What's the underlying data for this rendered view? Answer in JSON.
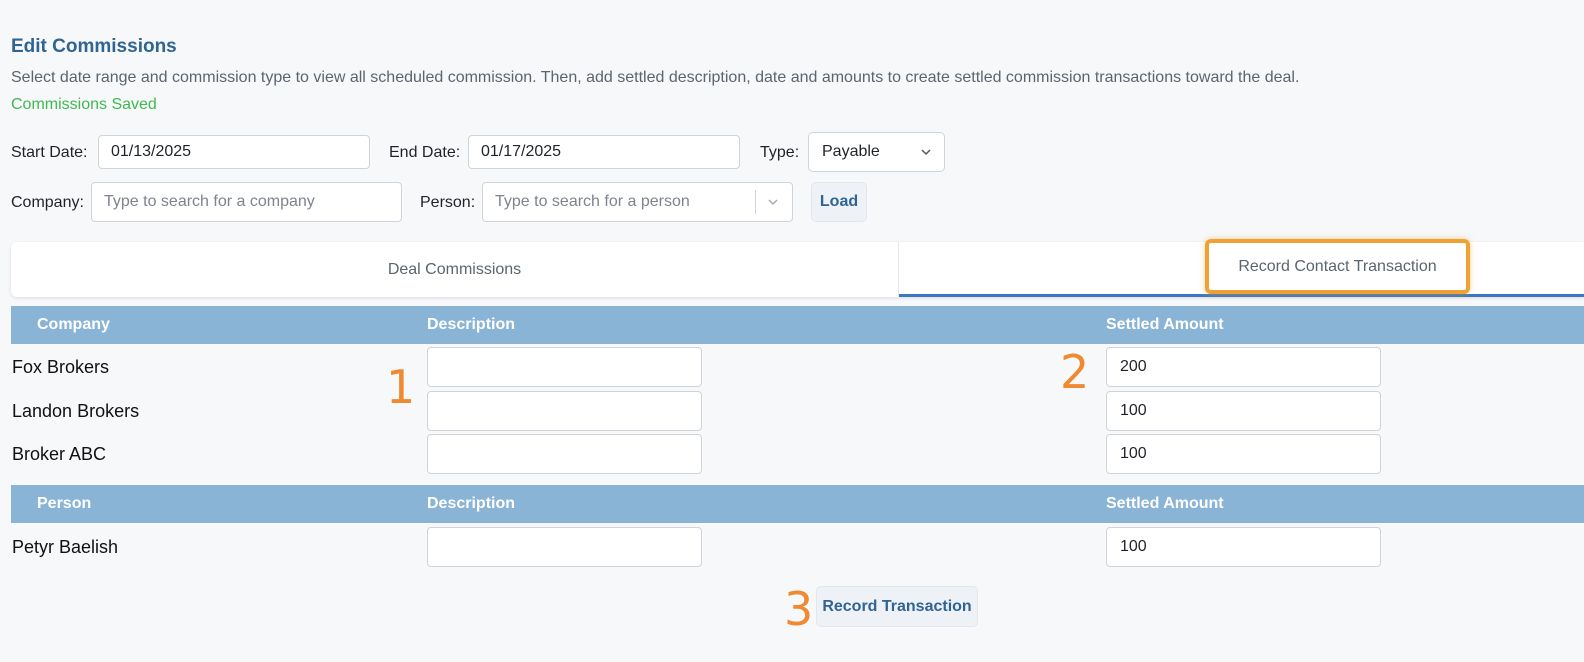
{
  "header": {
    "title": "Edit Commissions",
    "description": "Select date range and commission type to view all scheduled commission. Then, add settled description, date and amounts to create settled commission transactions toward the deal.",
    "status": "Commissions Saved"
  },
  "filters": {
    "start_label": "Start Date:",
    "start_value": "01/13/2025",
    "end_label": "End Date:",
    "end_value": "01/17/2025",
    "type_label": "Type:",
    "type_value": "Payable",
    "company_label": "Company:",
    "company_placeholder": "Type to search for a company",
    "person_label": "Person:",
    "person_placeholder": "Type to search for a person",
    "load_label": "Load"
  },
  "tabs": [
    {
      "label": "Deal Commissions"
    },
    {
      "label": "Record Contact Transaction"
    }
  ],
  "company_table": {
    "headers": [
      "Company",
      "Description",
      "Settled Amount"
    ],
    "rows": [
      {
        "name": "Fox Brokers",
        "description": "",
        "amount": "200"
      },
      {
        "name": "Landon Brokers",
        "description": "",
        "amount": "100"
      },
      {
        "name": "Broker ABC",
        "description": "",
        "amount": "100"
      }
    ]
  },
  "person_table": {
    "headers": [
      "Person",
      "Description",
      "Settled Amount"
    ],
    "rows": [
      {
        "name": "Petyr Baelish",
        "description": "",
        "amount": "100"
      }
    ]
  },
  "markers": [
    "1",
    "2",
    "3"
  ],
  "record_button": "Record Transaction",
  "colors": {
    "accent": "#2f6493",
    "header_bar": "#8ab4d6",
    "success": "#3fb950",
    "highlight": "#f0a134",
    "marker": "#f08a32"
  }
}
